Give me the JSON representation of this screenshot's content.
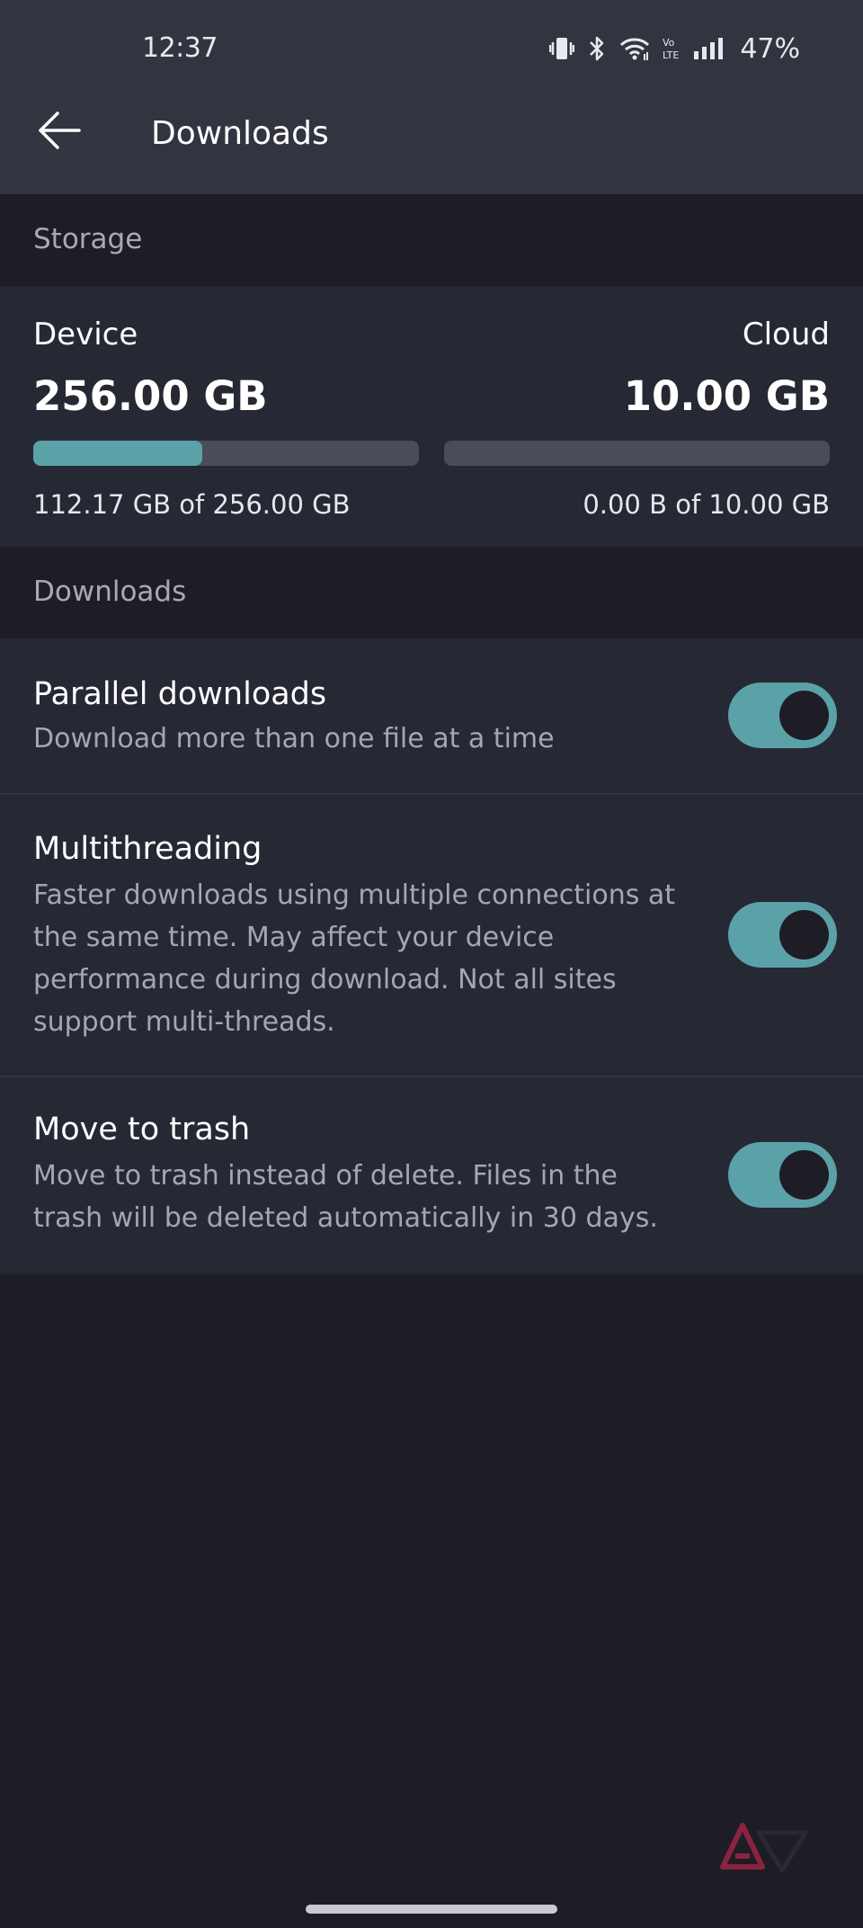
{
  "status_bar": {
    "time": "12:37",
    "battery": "47%",
    "icons": [
      "vibrate-icon",
      "bluetooth-icon",
      "wifi-icon",
      "volte-icon",
      "signal-icon"
    ]
  },
  "header": {
    "back_icon": "arrow-left-icon",
    "title": "Downloads"
  },
  "storage": {
    "section_label": "Storage",
    "device": {
      "name": "Device",
      "total": "256.00 GB",
      "used_text": "112.17 GB of 256.00 GB",
      "fraction_used": 0.438
    },
    "cloud": {
      "name": "Cloud",
      "total": "10.00 GB",
      "used_text": "0.00 B of 10.00 GB",
      "fraction_used": 0
    }
  },
  "downloads": {
    "section_label": "Downloads",
    "settings": [
      {
        "title": "Parallel downloads",
        "description": "Download more than one file at a time",
        "enabled": true
      },
      {
        "title": "Multithreading",
        "description": "Faster downloads using multiple connections at the same time. May affect your device performance during download. Not all sites support multi-threads.",
        "enabled": true
      },
      {
        "title": "Move to trash",
        "description": "Move to trash instead of delete. Files in the trash will be deleted automatically in 30 days.",
        "enabled": true
      }
    ]
  },
  "colors": {
    "accent": "#5ba1a8",
    "background": "#1e1d26",
    "card": "#262833",
    "app_bar": "#32343f",
    "track": "#4a4c5a"
  }
}
